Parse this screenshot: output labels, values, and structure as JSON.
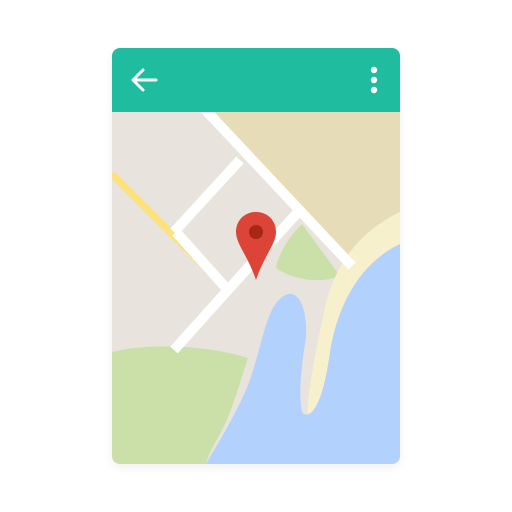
{
  "app_bar": {
    "color": "#1fbc9f",
    "back_icon": "arrow-back-icon",
    "menu_icon": "more-vert-icon"
  },
  "map": {
    "colors": {
      "land": "#e8e4dd",
      "sand": "#e6dcb8",
      "park": "#cbe0a9",
      "water": "#b3d1fd",
      "beach": "#f6f0cc",
      "road": "#ffffff",
      "highway": "#fde17a"
    },
    "marker": {
      "icon": "map-pin-icon",
      "color": "#db4437",
      "center_color": "#a52714"
    }
  }
}
